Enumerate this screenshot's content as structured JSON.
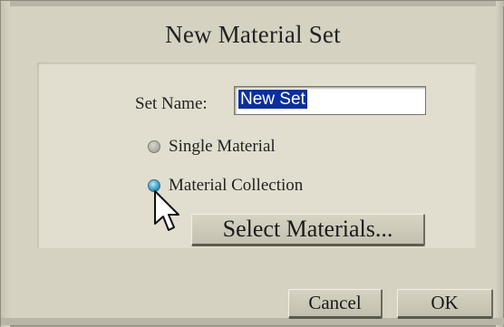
{
  "dialog": {
    "title": "New Material Set",
    "set_name": {
      "label": "Set Name:",
      "value": "New Set",
      "selected": true
    },
    "radios": [
      {
        "label": "Single Material",
        "checked": false
      },
      {
        "label": "Material Collection",
        "checked": true
      }
    ],
    "select_materials_label": "Select Materials...",
    "buttons": {
      "cancel": "Cancel",
      "ok": "OK"
    }
  },
  "icons": {
    "cursor": "arrow-pointer-icon"
  },
  "colors": {
    "dialog_bg": "#d6d2c2",
    "panel_bg": "#e2decf",
    "selection_bg": "#0a2f9e",
    "radio_active": "#3ea1cb"
  }
}
